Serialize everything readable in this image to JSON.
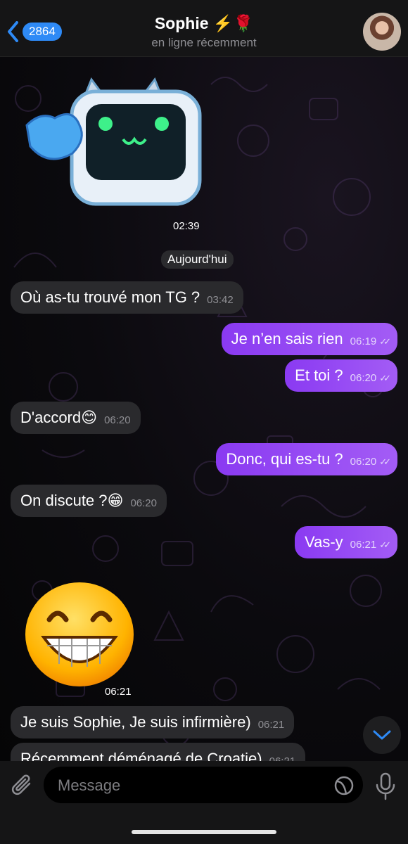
{
  "header": {
    "back_count": "2864",
    "contact_name": "Sophie ⚡️🌹",
    "status": "en ligne récemment"
  },
  "messages": {
    "sticker_robot_time": "02:39",
    "date_separator": "Aujourd'hui",
    "m1": {
      "text": "Où as-tu trouvé mon TG ?",
      "time": "03:42"
    },
    "m2": {
      "text": "Je n’en sais rien",
      "time": "06:19"
    },
    "m3": {
      "text": "Et toi ?",
      "time": "06:20"
    },
    "m4": {
      "text": "D'accord😊",
      "time": "06:20"
    },
    "m5": {
      "text": "Donc, qui es-tu ?",
      "time": "06:20"
    },
    "m6": {
      "text": "On discute ?😁",
      "time": "06:20"
    },
    "m7": {
      "text": "Vas-y",
      "time": "06:21"
    },
    "sticker_emoji_time": "06:21",
    "m8": {
      "text": "Je suis Sophie, Je suis infirmière)",
      "time": "06:21"
    },
    "m9": {
      "text": "Récemment déménagé de Croatie)",
      "time": "06:21"
    }
  },
  "input": {
    "placeholder": "Message"
  },
  "colors": {
    "outgoing": "#9a4ef4",
    "incoming": "#2a2a2d",
    "accent": "#2e8af6"
  }
}
